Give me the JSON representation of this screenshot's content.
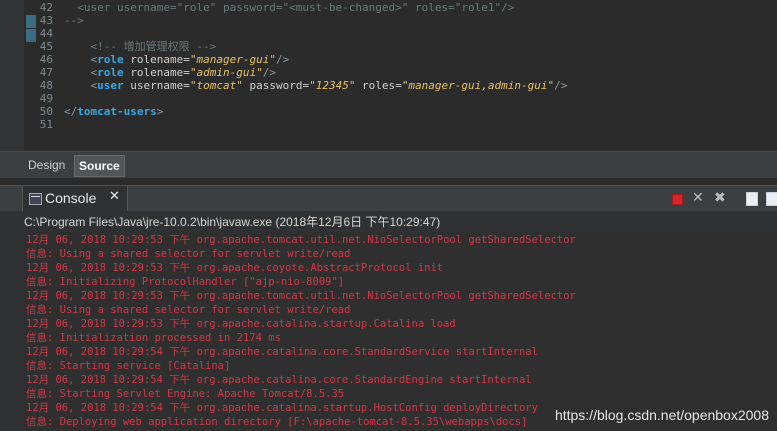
{
  "editor": {
    "lines": [
      {
        "n": "42",
        "segments": [
          {
            "t": "  <user ",
            "c": "c-comment"
          },
          {
            "t": "username",
            "c": "c-comment"
          },
          {
            "t": "=\"role\" password=\"<must-be-changed>\" roles=\"role1\"/>",
            "c": "c-comment"
          }
        ]
      },
      {
        "n": "43",
        "segments": [
          {
            "t": "-->",
            "c": "c-comment"
          }
        ]
      },
      {
        "n": "44",
        "segments": []
      },
      {
        "n": "45",
        "segments": [
          {
            "t": "    <!-- 增加管理权限 -->",
            "c": "c-comment"
          }
        ]
      },
      {
        "n": "46",
        "segments": [
          {
            "t": "    <",
            "c": "c-bracket"
          },
          {
            "t": "role",
            "c": "c-tag"
          },
          {
            "t": " rolename",
            "c": "c-attr"
          },
          {
            "t": "=",
            "c": "c-attr"
          },
          {
            "t": "\"manager-gui\"",
            "c": "c-val"
          },
          {
            "t": "/>",
            "c": "c-bracket"
          }
        ]
      },
      {
        "n": "47",
        "segments": [
          {
            "t": "    <",
            "c": "c-bracket"
          },
          {
            "t": "role",
            "c": "c-tag"
          },
          {
            "t": " rolename",
            "c": "c-attr"
          },
          {
            "t": "=",
            "c": "c-attr"
          },
          {
            "t": "\"admin-gui\"",
            "c": "c-val"
          },
          {
            "t": "/>",
            "c": "c-bracket"
          }
        ]
      },
      {
        "n": "48",
        "segments": [
          {
            "t": "    <",
            "c": "c-bracket"
          },
          {
            "t": "user",
            "c": "c-tag"
          },
          {
            "t": " username",
            "c": "c-attr"
          },
          {
            "t": "=",
            "c": "c-attr"
          },
          {
            "t": "\"tomcat\"",
            "c": "c-val"
          },
          {
            "t": " password",
            "c": "c-attr"
          },
          {
            "t": "=",
            "c": "c-attr"
          },
          {
            "t": "\"12345\"",
            "c": "c-val"
          },
          {
            "t": " roles",
            "c": "c-attr"
          },
          {
            "t": "=",
            "c": "c-attr"
          },
          {
            "t": "\"manager-gui,admin-gui\"",
            "c": "c-val"
          },
          {
            "t": "/>",
            "c": "c-bracket"
          }
        ]
      },
      {
        "n": "49",
        "segments": []
      },
      {
        "n": "50",
        "segments": [
          {
            "t": "</",
            "c": "c-bracket"
          },
          {
            "t": "tomcat-users",
            "c": "c-tag"
          },
          {
            "t": ">",
            "c": "c-bracket"
          }
        ]
      },
      {
        "n": "51",
        "segments": []
      }
    ]
  },
  "editor_tabs": {
    "design": "Design",
    "source": "Source"
  },
  "console": {
    "title": "Console",
    "close": "✕",
    "process": "C:\\Program Files\\Java\\jre-10.0.2\\bin\\javaw.exe (2018年12月6日 下午10:29:47)",
    "output": [
      "12月 06, 2018 10:29:53 下午 org.apache.tomcat.util.net.NioSelectorPool getSharedSelector",
      "信息: Using a shared selector for servlet write/read",
      "12月 06, 2018 10:29:53 下午 org.apache.coyote.AbstractProtocol init",
      "信息: Initializing ProtocolHandler [\"ajp-nio-8009\"]",
      "12月 06, 2018 10:29:53 下午 org.apache.tomcat.util.net.NioSelectorPool getSharedSelector",
      "信息: Using a shared selector for servlet write/read",
      "12月 06, 2018 10:29:53 下午 org.apache.catalina.startup.Catalina load",
      "信息: Initialization processed in 2174 ms",
      "12月 06, 2018 10:29:54 下午 org.apache.catalina.core.StandardService startInternal",
      "信息: Starting service [Catalina]",
      "12月 06, 2018 10:29:54 下午 org.apache.catalina.core.StandardEngine startInternal",
      "信息: Starting Servlet Engine: Apache Tomcat/8.5.35",
      "12月 06, 2018 10:29:54 下午 org.apache.catalina.startup.HostConfig deployDirectory",
      "信息: Deploying web application directory [F:\\apache-tomcat-8.5.35\\webapps\\docs]"
    ]
  },
  "toolbar": {
    "terminate_icon": "stop-icon",
    "remove_launch_icon": "remove-launch-icon",
    "remove_all_icon": "remove-all-terminated-icon",
    "doc_icon": "pin-console-icon"
  },
  "watermark": "https://blog.csdn.net/openbox2008",
  "colors": {
    "error_text": "#d2384a",
    "tag": "#3aa6df",
    "value": "#e8c267",
    "stop": "#d9262c"
  }
}
